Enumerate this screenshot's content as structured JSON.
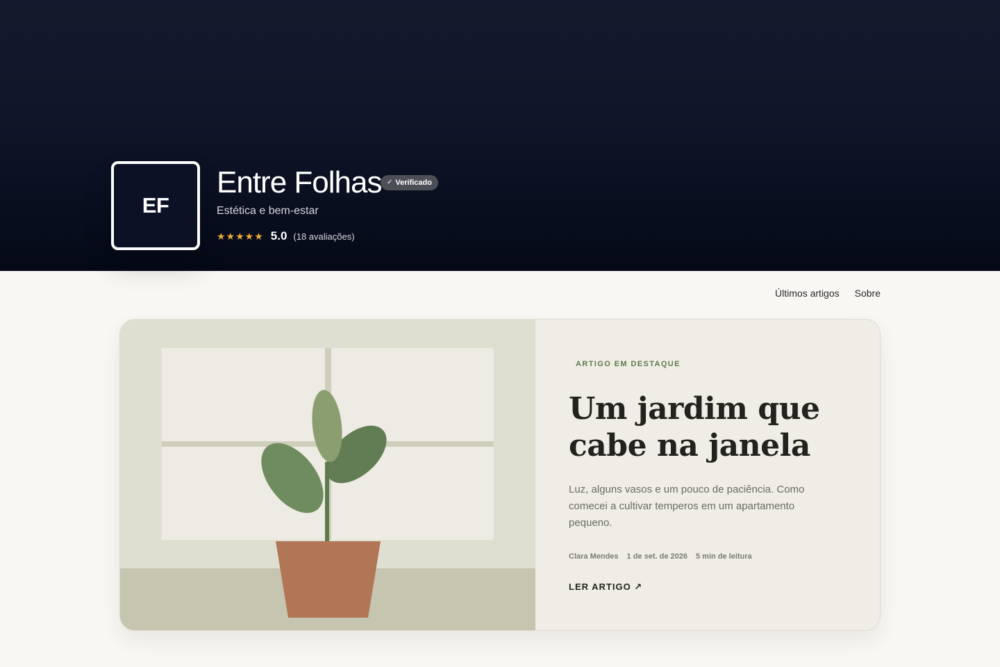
{
  "header": {
    "logo_initials": "EF",
    "brand_name": "Entre Folhas",
    "verified_label": "Verificado",
    "tagline": "Estética e bem-estar",
    "rating": {
      "stars": "★★★★★",
      "score": "5.0",
      "count_label": "(18 avaliações)"
    }
  },
  "nav": {
    "items": [
      {
        "label": "Últimos artigos"
      },
      {
        "label": "Sobre"
      }
    ]
  },
  "featured": {
    "eyebrow": "ARTIGO EM DESTAQUE",
    "title": "Um jardim que cabe na janela",
    "excerpt": "Luz, alguns vasos e um pouco de paciência. Como comecei a cultivar temperos em um apartamento pequeno.",
    "author": "Clara Mendes",
    "date": "1 de set. de 2026",
    "read_time": "5 min de leitura",
    "cta_label": "LER ARTIGO ↗"
  },
  "colors": {
    "hero_top": "#141a2d",
    "hero_bottom": "#050917",
    "accent_green": "#5f7a50",
    "star": "#f0a93a",
    "pot": "#b07655",
    "page_bg": "#f9f7f3"
  }
}
